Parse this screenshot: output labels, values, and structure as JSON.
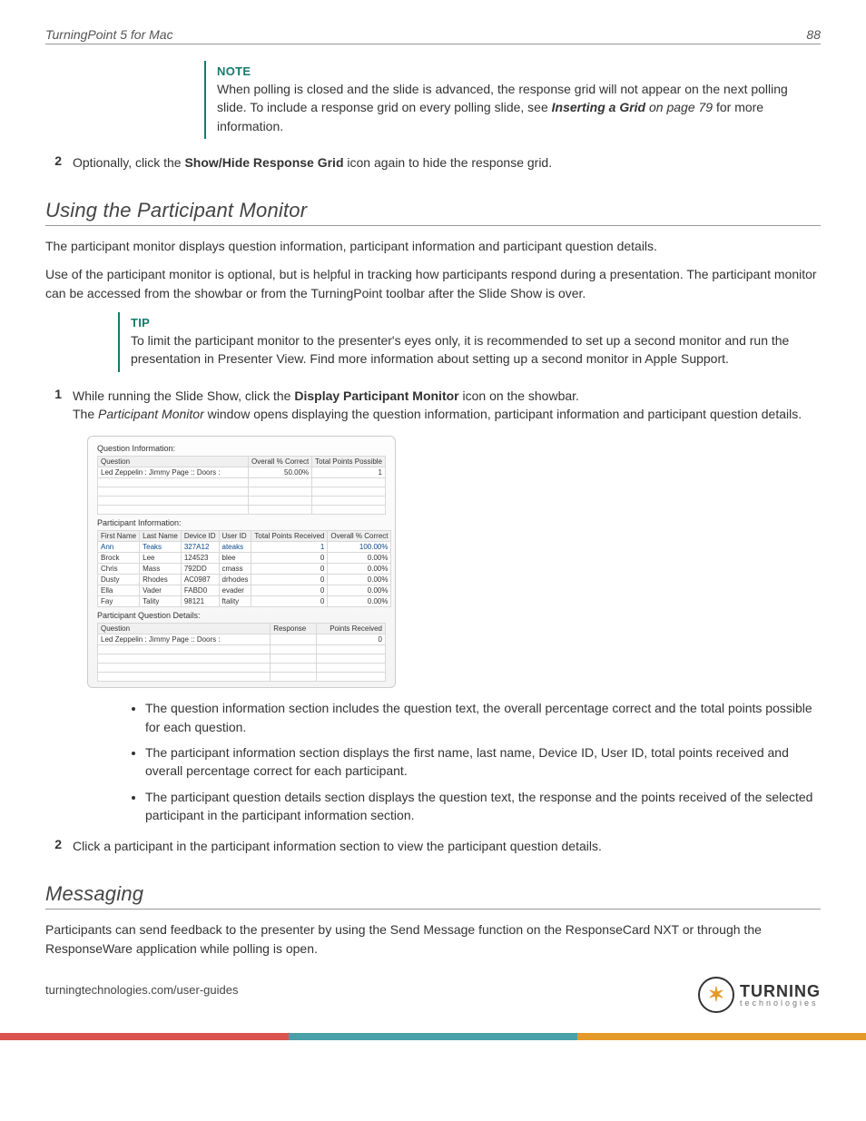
{
  "header": {
    "title": "TurningPoint 5 for Mac",
    "page_number": "88"
  },
  "note": {
    "label": "NOTE",
    "text_1": "When polling is closed and the slide is advanced, the response grid will not appear on the next polling slide. To include a response grid on every polling slide, see ",
    "ref": "Inserting a Grid",
    "ref_page": " on page 79",
    "text_2": " for more information."
  },
  "step_note_2": {
    "num": "2",
    "pre": "Optionally, click the ",
    "bold": "Show/Hide Response Grid",
    "post": " icon again to hide the response grid."
  },
  "section_monitor": {
    "heading": "Using the Participant Monitor",
    "para1": "The participant monitor displays question information, participant information and participant question details.",
    "para2": "Use of the participant monitor is optional, but is helpful in tracking how participants respond during a presentation. The participant monitor can be accessed from the showbar or from the TurningPoint toolbar after the Slide Show is over."
  },
  "tip": {
    "label": "TIP",
    "text": "To limit the participant monitor to the presenter's eyes only, it is recommended to set up a second monitor and run the presentation in Presenter View. Find more information about setting up a second monitor in Apple Support."
  },
  "step_monitor_1": {
    "num": "1",
    "pre": "While running the Slide Show, click the ",
    "bold": "Display Participant Monitor",
    "post": " icon on the showbar.",
    "sentence2_pre": "The ",
    "sentence2_ital": "Participant Monitor",
    "sentence2_post": " window opens displaying the question information, participant information and participant question details."
  },
  "screenshot": {
    "qinfo_title": "Question Information:",
    "qinfo_headers": [
      "Question",
      "Overall % Correct",
      "Total Points Possible"
    ],
    "qinfo_row": [
      "Led Zeppelin : Jimmy Page :: Doors :",
      "50.00%",
      "1"
    ],
    "pinfo_title": "Participant Information:",
    "pinfo_headers": [
      "First Name",
      "Last Name",
      "Device ID",
      "User ID",
      "Total Points Received",
      "Overall % Correct"
    ],
    "pinfo_rows": [
      [
        "Ann",
        "Teaks",
        "327A12",
        "ateaks",
        "1",
        "100.00%"
      ],
      [
        "Brock",
        "Lee",
        "124523",
        "blee",
        "0",
        "0.00%"
      ],
      [
        "Chris",
        "Mass",
        "792DD",
        "cmass",
        "0",
        "0.00%"
      ],
      [
        "Dusty",
        "Rhodes",
        "AC0987",
        "drhodes",
        "0",
        "0.00%"
      ],
      [
        "Ella",
        "Vader",
        "FABD0",
        "evader",
        "0",
        "0.00%"
      ],
      [
        "Fay",
        "Tality",
        "98121",
        "ftality",
        "0",
        "0.00%"
      ]
    ],
    "pqd_title": "Participant Question Details:",
    "pqd_headers": [
      "Question",
      "Response",
      "Points Received"
    ],
    "pqd_row": [
      "Led Zeppelin : Jimmy Page :: Doors :",
      "",
      "0"
    ]
  },
  "bullets": {
    "b1": "The question information section includes the question text, the overall percentage correct and the total points possible for each question.",
    "b2": "The participant information section displays the first name, last name, Device ID, User ID, total points received and overall percentage correct for each participant.",
    "b3": "The participant question details section displays the question text, the response and the points received of the selected participant in the participant information section."
  },
  "step_monitor_2": {
    "num": "2",
    "text": "Click a participant in the participant information section to view the participant question details."
  },
  "section_messaging": {
    "heading": "Messaging",
    "para": "Participants can send feedback to the presenter by using the Send Message function on the ResponseCard NXT or through the ResponseWare application while polling is open."
  },
  "footer": {
    "url": "turningtechnologies.com/user-guides"
  },
  "logo": {
    "main": "TURNING",
    "sub": "technologies"
  }
}
